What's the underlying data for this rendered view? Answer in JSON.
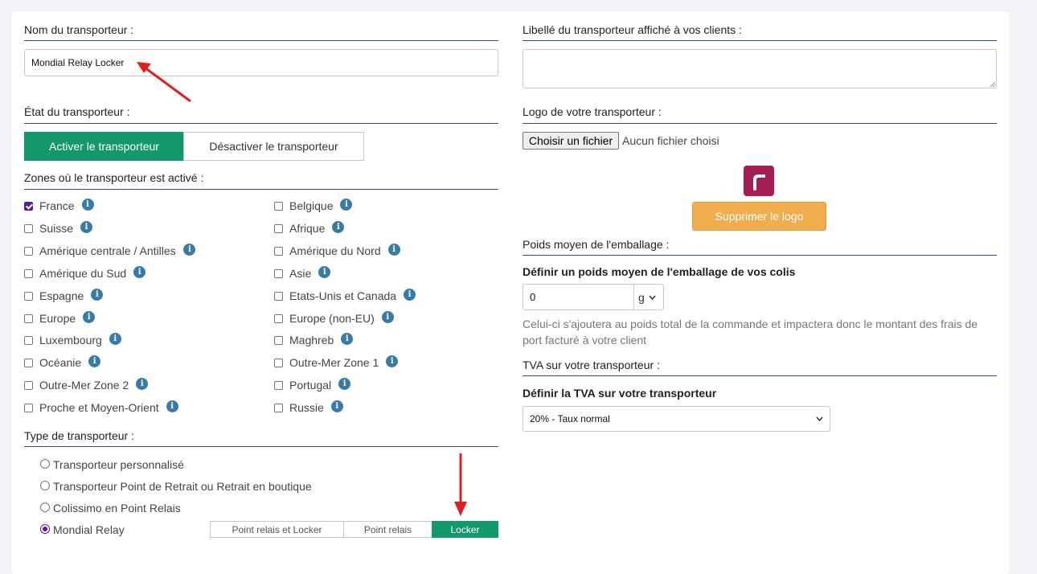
{
  "carrier_name": {
    "label": "Nom du transporteur :",
    "value": "Mondial Relay Locker"
  },
  "carrier_state": {
    "label": "État du transporteur :",
    "activate": "Activer le transporteur",
    "deactivate": "Désactiver le transporteur"
  },
  "zones": {
    "label": "Zones où le transporteur est activé :",
    "left": [
      {
        "name": "France",
        "checked": true
      },
      {
        "name": "Suisse",
        "checked": false
      },
      {
        "name": "Amérique centrale / Antilles",
        "checked": false
      },
      {
        "name": "Amérique du Sud",
        "checked": false
      },
      {
        "name": "Espagne",
        "checked": false
      },
      {
        "name": "Europe",
        "checked": false
      },
      {
        "name": "Luxembourg",
        "checked": false
      },
      {
        "name": "Océanie",
        "checked": false
      },
      {
        "name": "Outre-Mer Zone 2",
        "checked": false
      },
      {
        "name": "Proche et Moyen-Orient",
        "checked": false
      }
    ],
    "right": [
      {
        "name": "Belgique",
        "checked": false
      },
      {
        "name": "Afrique",
        "checked": false
      },
      {
        "name": "Amérique du Nord",
        "checked": false
      },
      {
        "name": "Asie",
        "checked": false
      },
      {
        "name": "Etats-Unis et Canada",
        "checked": false
      },
      {
        "name": "Europe (non-EU)",
        "checked": false
      },
      {
        "name": "Maghreb",
        "checked": false
      },
      {
        "name": "Outre-Mer Zone 1",
        "checked": false
      },
      {
        "name": "Portugal",
        "checked": false
      },
      {
        "name": "Russie",
        "checked": false
      }
    ]
  },
  "carrier_type": {
    "label": "Type de transporteur :",
    "options": [
      {
        "name": "Transporteur personnalisé",
        "checked": false
      },
      {
        "name": "Transporteur Point de Retrait ou Retrait en boutique",
        "checked": false
      },
      {
        "name": "Colissimo en Point Relais",
        "checked": false
      },
      {
        "name": "Mondial Relay",
        "checked": true
      }
    ],
    "segments": [
      "Point relais et Locker",
      "Point relais",
      "Locker"
    ],
    "selected_segment": "Locker"
  },
  "display_label": {
    "label": "Libellé du transporteur affiché à vos clients :",
    "value": ""
  },
  "logo": {
    "label": "Logo de votre transporteur :",
    "file_button": "Choisir un fichier",
    "file_status": "Aucun fichier choisi",
    "remove_button": "Supprimer le logo",
    "brand_color": "#a51d57"
  },
  "packaging": {
    "section": "Poids moyen de l'emballage :",
    "label": "Définir un poids moyen de l'emballage de vos colis",
    "value": "0",
    "unit": "g",
    "help": "Celui-ci s'ajoutera au poids total de la commande et impactera donc le montant des frais de port facturé à votre client"
  },
  "vat": {
    "section": "TVA sur votre transporteur :",
    "label": "Définir la TVA sur votre transporteur",
    "selected": "20% - Taux normal"
  },
  "colors": {
    "accent_green": "#13986a",
    "section_line": "#2e4b8f",
    "info_icon": "#3a7aa8",
    "remove_button": "#f0ad4e",
    "annotation_arrow": "#e02020"
  }
}
